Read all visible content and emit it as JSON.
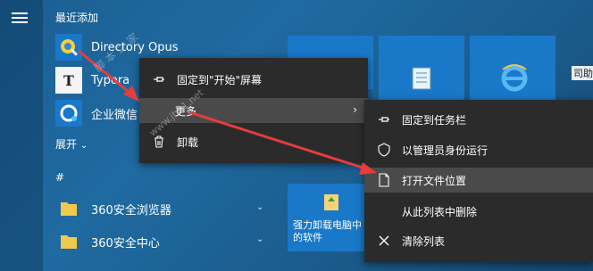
{
  "start": {
    "section_title": "最近添加",
    "apps": [
      {
        "label": "Directory Opus"
      },
      {
        "label": "Typora"
      },
      {
        "label": "企业微信"
      }
    ],
    "expand_label": "展开",
    "group_hash": "#",
    "alpha_apps": [
      {
        "label": "360安全浏览器"
      },
      {
        "label": "360安全中心"
      }
    ],
    "tile_label": "强力卸载电脑中的软件",
    "edge_tile_text": "司助"
  },
  "context_menu": {
    "items": [
      {
        "label": "固定到\"开始\"屏幕"
      },
      {
        "label": "更多"
      },
      {
        "label": "卸载"
      }
    ]
  },
  "sub_menu": {
    "items": [
      {
        "label": "固定到任务栏"
      },
      {
        "label": "以管理员身份运行"
      },
      {
        "label": "打开文件位置"
      },
      {
        "label": "从此列表中删除"
      },
      {
        "label": "清除列表"
      }
    ]
  },
  "watermark": {
    "text1": "脚 本 之 家",
    "text2": "www.jb51.net"
  },
  "colors": {
    "menu_bg": "#2b2b2b",
    "highlight": "#4a4a4a",
    "tile_blue": "#1a78c9",
    "arrow_red": "#e63c3c"
  }
}
